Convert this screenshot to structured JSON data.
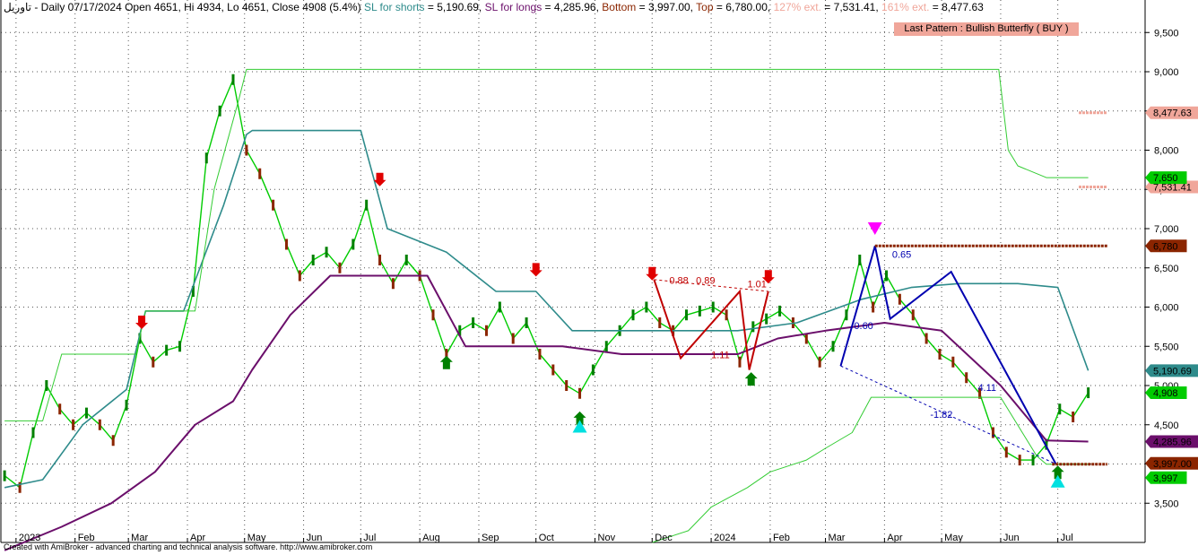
{
  "header": {
    "symbol": "تاوريل",
    "info": " - Daily 07/17/2024 Open 4651, Hi 4934, Lo 4651, Close 4908 (5.4%)",
    "sl_shorts_label": "SL for shorts",
    "sl_shorts_value": " = 5,190.69,",
    "sl_longs_label": "SL for longs",
    "sl_longs_value": " = 4,285.96,",
    "bottom_label": "Bottom",
    "bottom_value": " = 3,997.00,",
    "top_label": "Top",
    "top_value": " = 6,780.00,",
    "ext127_label": "127% ext.",
    "ext127_value": " = 7,531.41,",
    "ext161_label": "161% ext.",
    "ext161_value": " = 8,477.63"
  },
  "pattern_label": "Last Pattern : Bullish Butterfly ( BUY )",
  "footer": "Created with AmiBroker - advanced charting and technical analysis software. http://www.amibroker.com",
  "colors": {
    "sl_shorts": "#2e8b8b",
    "sl_longs": "#6b0f6b",
    "bottom": "#8b2500",
    "top": "#8b2500",
    "ext127": "#f0a69a",
    "ext161": "#f0a69a",
    "trail_up": "#33cc33",
    "close": "#00cc00",
    "bearish": "#8b2500",
    "bullish": "#008000",
    "pattern": "#0000b0",
    "xabcd_red": "#c00000"
  },
  "chart_data": {
    "type": "line",
    "title": "",
    "ylim": [
      3000,
      9800
    ],
    "y_ticks": [
      3500,
      4000,
      4500,
      5000,
      5500,
      6000,
      6500,
      7000,
      7500,
      8000,
      8500,
      9000,
      9500
    ],
    "y_tick_labels": [
      "3,500",
      "4,000",
      "4,500",
      "5,000",
      "5,500",
      "6,000",
      "6,500",
      "7,000",
      "7,500",
      "8,000",
      "8,500",
      "9,000",
      "9,500"
    ],
    "x_labels": [
      "2023",
      "Feb",
      "Mar",
      "Apr",
      "May",
      "Jun",
      "Jul",
      "Aug",
      "Sep",
      "Oct",
      "Nov",
      "Dec",
      "2024",
      "Feb",
      "Mar",
      "Apr",
      "May",
      "Jun",
      "Jul"
    ],
    "x_label_dates": [
      "2023-01-01",
      "2023-02-01",
      "2023-03-01",
      "2023-04-01",
      "2023-05-01",
      "2023-06-01",
      "2023-07-01",
      "2023-08-01",
      "2023-09-01",
      "2023-10-01",
      "2023-11-01",
      "2023-12-01",
      "2024-01-01",
      "2024-02-01",
      "2024-03-01",
      "2024-04-01",
      "2024-05-01",
      "2024-06-01",
      "2024-07-01"
    ],
    "xlim": [
      "2022-12-25",
      "2024-07-28"
    ],
    "series": [
      {
        "name": "Close",
        "dates": [
          "2022-12-26",
          "2023-01-03",
          "2023-01-10",
          "2023-01-17",
          "2023-01-24",
          "2023-01-31",
          "2023-02-07",
          "2023-02-14",
          "2023-02-21",
          "2023-02-28",
          "2023-03-07",
          "2023-03-14",
          "2023-03-21",
          "2023-03-28",
          "2023-04-04",
          "2023-04-11",
          "2023-04-18",
          "2023-04-25",
          "2023-05-02",
          "2023-05-09",
          "2023-05-16",
          "2023-05-23",
          "2023-05-30",
          "2023-06-06",
          "2023-06-13",
          "2023-06-20",
          "2023-06-27",
          "2023-07-04",
          "2023-07-11",
          "2023-07-18",
          "2023-07-25",
          "2023-08-01",
          "2023-08-08",
          "2023-08-15",
          "2023-08-22",
          "2023-08-29",
          "2023-09-05",
          "2023-09-12",
          "2023-09-19",
          "2023-09-26",
          "2023-10-03",
          "2023-10-10",
          "2023-10-17",
          "2023-10-24",
          "2023-10-31",
          "2023-11-07",
          "2023-11-14",
          "2023-11-21",
          "2023-11-28",
          "2023-12-05",
          "2023-12-12",
          "2023-12-19",
          "2023-12-26",
          "2024-01-02",
          "2024-01-09",
          "2024-01-16",
          "2024-01-23",
          "2024-01-30",
          "2024-02-06",
          "2024-02-13",
          "2024-02-20",
          "2024-02-27",
          "2024-03-05",
          "2024-03-12",
          "2024-03-19",
          "2024-03-26",
          "2024-04-02",
          "2024-04-09",
          "2024-04-16",
          "2024-04-23",
          "2024-04-30",
          "2024-05-07",
          "2024-05-14",
          "2024-05-21",
          "2024-05-28",
          "2024-06-04",
          "2024-06-11",
          "2024-06-18",
          "2024-06-25",
          "2024-07-02",
          "2024-07-09",
          "2024-07-17"
        ],
        "values": [
          3850,
          3700,
          4400,
          5000,
          4700,
          4500,
          4650,
          4500,
          4300,
          4750,
          5600,
          5300,
          5450,
          5500,
          6200,
          7900,
          8500,
          8900,
          8000,
          7700,
          7300,
          6800,
          6400,
          6600,
          6700,
          6500,
          6800,
          7300,
          6600,
          6300,
          6600,
          6400,
          5900,
          5400,
          5700,
          5800,
          5700,
          6000,
          5600,
          5800,
          5400,
          5200,
          5000,
          4900,
          5200,
          5500,
          5700,
          5900,
          6000,
          5800,
          5700,
          5900,
          5950,
          6000,
          5900,
          5300,
          5750,
          5850,
          5950,
          5800,
          5600,
          5300,
          5500,
          5900,
          6600,
          6000,
          6400,
          6100,
          5900,
          5600,
          5400,
          5300,
          5100,
          4900,
          4400,
          4150,
          4050,
          4050,
          4250,
          4700,
          4600,
          4908
        ]
      },
      {
        "name": "SL for shorts",
        "dates": [
          "2022-12-26",
          "2023-01-15",
          "2023-02-05",
          "2023-02-28",
          "2023-03-10",
          "2023-03-30",
          "2023-04-20",
          "2023-05-02",
          "2023-05-05",
          "2023-06-01",
          "2023-07-01",
          "2023-07-15",
          "2023-08-15",
          "2023-09-10",
          "2023-10-01",
          "2023-10-20",
          "2023-11-10",
          "2023-12-01",
          "2024-01-15",
          "2024-02-15",
          "2024-03-20",
          "2024-04-15",
          "2024-05-10",
          "2024-06-10",
          "2024-07-01",
          "2024-07-17"
        ],
        "values": [
          3700,
          3800,
          4500,
          4950,
          5950,
          5950,
          7300,
          8200,
          8250,
          8250,
          8250,
          7000,
          6700,
          6200,
          6200,
          5700,
          5700,
          5700,
          5700,
          5800,
          6100,
          6250,
          6300,
          6300,
          6250,
          5190.69
        ]
      },
      {
        "name": "SL for longs",
        "dates": [
          "2022-12-26",
          "2023-01-25",
          "2023-02-20",
          "2023-03-15",
          "2023-04-05",
          "2023-04-25",
          "2023-05-05",
          "2023-05-25",
          "2023-06-15",
          "2023-07-05",
          "2023-08-05",
          "2023-08-25",
          "2023-09-15",
          "2023-10-15",
          "2023-11-15",
          "2023-12-15",
          "2024-01-15",
          "2024-02-05",
          "2024-03-01",
          "2024-04-01",
          "2024-05-01",
          "2024-06-01",
          "2024-06-25",
          "2024-07-17"
        ],
        "values": [
          2900,
          3200,
          3500,
          3900,
          4500,
          4800,
          5200,
          5900,
          6400,
          6400,
          6400,
          5500,
          5500,
          5500,
          5400,
          5400,
          5400,
          5600,
          5700,
          5800,
          5700,
          5000,
          4300,
          4285.96
        ]
      },
      {
        "name": "Trailing stop (up)",
        "dates": [
          "2022-12-26",
          "2023-01-15",
          "2023-01-25",
          "2023-02-20",
          "2023-03-05",
          "2023-03-10",
          "2023-03-20",
          "2023-04-05",
          "2023-04-15",
          "2023-04-28",
          "2023-05-02",
          "2023-06-01",
          "2023-08-01",
          "2023-10-01",
          "2023-12-01",
          "2024-01-01",
          "2024-02-01",
          "2024-03-01",
          "2024-04-01",
          "2024-05-01",
          "2024-05-31",
          "2024-06-05",
          "2024-06-10",
          "2024-06-25",
          "2024-07-17"
        ],
        "values": [
          4550,
          4550,
          5400,
          5400,
          5400,
          5950,
          5950,
          5950,
          7500,
          8650,
          9030,
          9030,
          9030,
          9030,
          9030,
          9030,
          9030,
          9030,
          9030,
          9030,
          9030,
          8000,
          7800,
          7650,
          7650
        ]
      },
      {
        "name": "Trailing stop (down)",
        "dates": [
          "2023-12-01",
          "2023-12-20",
          "2024-01-01",
          "2024-01-20",
          "2024-02-01",
          "2024-02-20",
          "2024-03-01",
          "2024-03-15",
          "2024-03-25",
          "2024-05-01",
          "2024-06-01",
          "2024-06-20",
          "2024-06-25",
          "2024-07-17"
        ],
        "values": [
          3000,
          3150,
          3450,
          3700,
          3900,
          4050,
          4200,
          4400,
          4850,
          4850,
          4850,
          4100,
          3997,
          3997
        ]
      }
    ],
    "levels": [
      {
        "name": "SL for shorts",
        "value": 5190.69,
        "label": "5,190.69"
      },
      {
        "name": "SL for longs",
        "value": 4285.96,
        "label": "4,285.96"
      },
      {
        "name": "Bottom",
        "value": 3997,
        "label": "3,997"
      },
      {
        "name": "Bottom",
        "value": 3997,
        "label": "3,997.00"
      },
      {
        "name": "Top",
        "value": 6780,
        "label": "6,780"
      },
      {
        "name": "127% ext.",
        "value": 7531.41,
        "label": "7,531.41"
      },
      {
        "name": "161% ext.",
        "value": 8477.63,
        "label": "8,477.63"
      },
      {
        "name": "Close",
        "value": 4908,
        "label": "4,908"
      },
      {
        "name": "Trailing stop",
        "value": 7650,
        "label": "7,650"
      }
    ],
    "annotations": [
      {
        "text": "0.88",
        "date": "2023-12-10",
        "value": 6300
      },
      {
        "text": "0.89",
        "date": "2023-12-24",
        "value": 6300
      },
      {
        "text": "1.01",
        "date": "2024-01-20",
        "value": 6250
      },
      {
        "text": "1.11",
        "date": "2024-01-01",
        "value": 5350
      },
      {
        "text": "0.65",
        "date": "2024-04-05",
        "value": 6630
      },
      {
        "text": "0.60",
        "date": "2024-03-16",
        "value": 5720
      },
      {
        "text": "4.11",
        "date": "2024-05-20",
        "value": 4930
      },
      {
        "text": "-1.82",
        "date": "2024-04-25",
        "value": 4590
      }
    ],
    "signals": [
      {
        "type": "sell",
        "date": "2023-03-08",
        "value": 5800
      },
      {
        "type": "sell",
        "date": "2023-07-11",
        "value": 7620
      },
      {
        "type": "sell",
        "date": "2023-10-01",
        "value": 6470
      },
      {
        "type": "sell",
        "date": "2023-12-01",
        "value": 6420
      },
      {
        "type": "sell",
        "date": "2024-01-31",
        "value": 6380
      },
      {
        "type": "buy",
        "date": "2023-08-15",
        "value": 5300
      },
      {
        "type": "buy",
        "date": "2023-10-24",
        "value": 4590
      },
      {
        "type": "buy",
        "date": "2024-01-22",
        "value": 5090
      },
      {
        "type": "buy",
        "date": "2024-07-01",
        "value": 3900
      },
      {
        "type": "pattern-buy",
        "date": "2023-10-24",
        "value": 4480
      },
      {
        "type": "pattern-buy",
        "date": "2024-07-01",
        "value": 3780
      },
      {
        "type": "pattern-sell",
        "date": "2024-03-27",
        "value": 7000
      }
    ],
    "pattern_lines": [
      {
        "dates": [
          "2023-12-02",
          "2023-12-16",
          "2024-01-16",
          "2024-01-21",
          "2024-01-31"
        ],
        "values": [
          6350,
          5350,
          6200,
          5200,
          6200
        ]
      },
      {
        "dates": [
          "2024-03-09",
          "2024-03-27",
          "2024-04-04",
          "2024-05-06",
          "2024-06-30"
        ],
        "values": [
          5250,
          6780,
          5850,
          6450,
          4000
        ]
      }
    ],
    "grid": true,
    "legend": "none"
  }
}
